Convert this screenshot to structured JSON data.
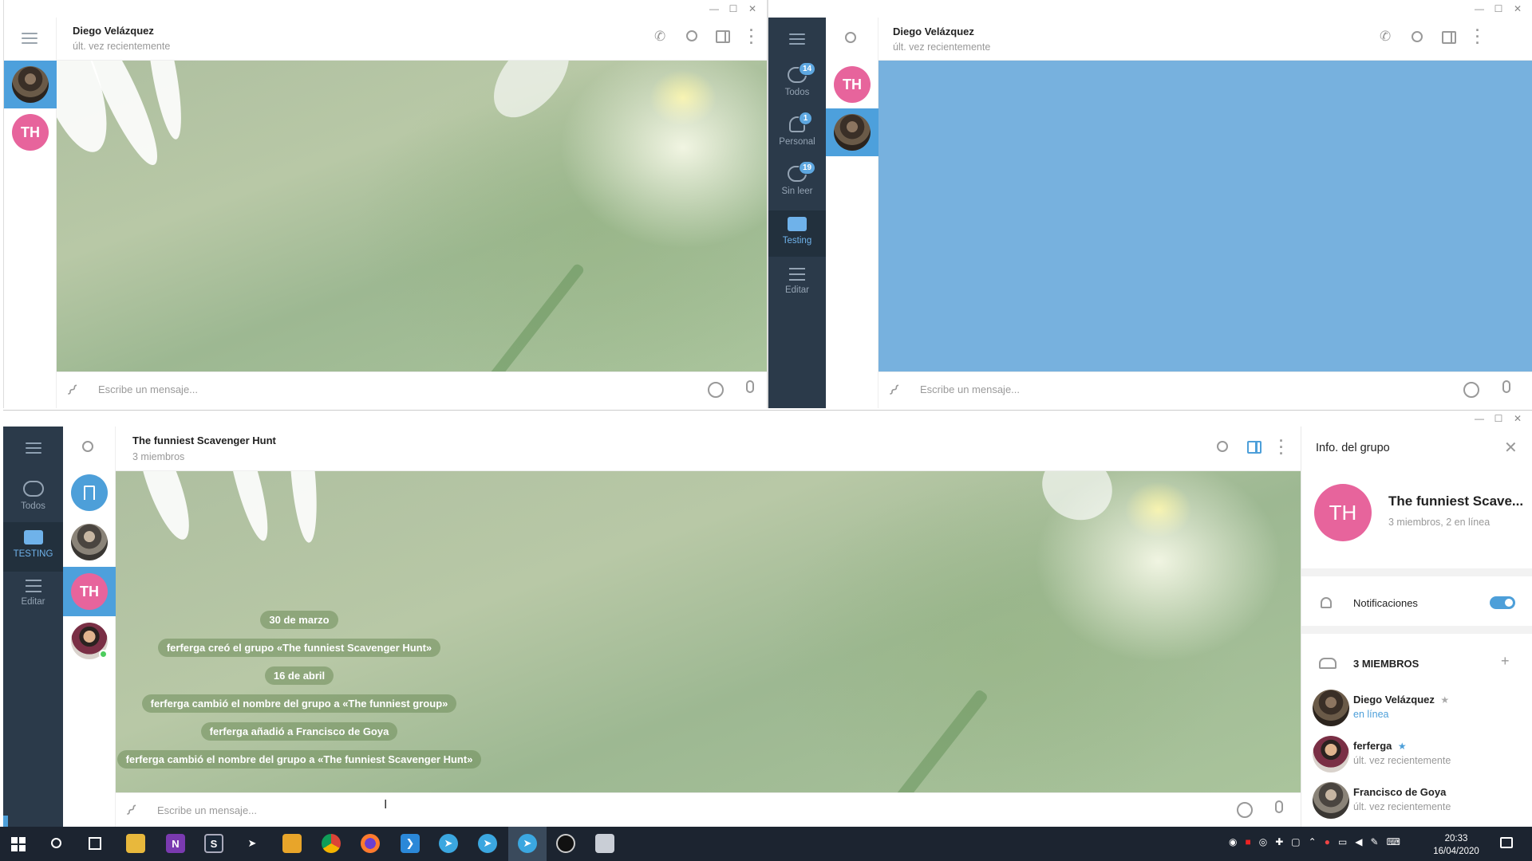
{
  "window_top_left": {
    "chat_title": "Diego Velázquez",
    "chat_status": "últ. vez recientemente",
    "composer_placeholder": "Escribe un mensaje...",
    "avatar_th": "TH"
  },
  "window_top_right": {
    "chat_title": "Diego Velázquez",
    "chat_status": "últ. vez recientemente",
    "composer_placeholder": "Escribe un mensaje...",
    "avatar_th": "TH",
    "folders": [
      {
        "label": "Todos",
        "badge": "14"
      },
      {
        "label": "Personal",
        "badge": "1"
      },
      {
        "label": "Sin leer",
        "badge": "19"
      },
      {
        "label": "Testing",
        "badge": ""
      },
      {
        "label": "Editar",
        "badge": ""
      }
    ]
  },
  "window_bottom": {
    "chat_title": "The funniest Scavenger Hunt",
    "chat_subtitle": "3 miembros",
    "composer_placeholder": "Escribe un mensaje...",
    "avatar_th": "TH",
    "folders": [
      {
        "label": "Todos"
      },
      {
        "label": "TESTING"
      },
      {
        "label": "Editar"
      }
    ],
    "service_messages": [
      "30 de marzo",
      "ferferga creó el grupo «The funniest Scavenger Hunt»",
      "16 de abril",
      "ferferga cambió el nombre del grupo a «The funniest group»",
      "ferferga añadió a Francisco de Goya",
      "ferferga cambió el nombre del grupo a «The funniest Scavenger Hunt»"
    ],
    "info_panel": {
      "title": "Info. del grupo",
      "group_avatar": "TH",
      "group_name": "The funniest Scave...",
      "group_stats": "3 miembros, 2 en línea",
      "notifications_label": "Notificaciones",
      "notifications_on": true,
      "members_header": "3 MIEMBROS",
      "members": [
        {
          "name": "Diego Velázquez",
          "star": "★",
          "status": "en línea"
        },
        {
          "name": "ferferga",
          "star": "★",
          "status": "últ. vez recientemente"
        },
        {
          "name": "Francisco de Goya",
          "star": "",
          "status": "últ. vez recientemente"
        }
      ]
    }
  },
  "taskbar": {
    "time": "20:33",
    "date": "16/04/2020"
  },
  "colors": {
    "sidebar_dark": "#2b3a4a",
    "accent": "#5ea7e0",
    "avatar_pink": "#e7649c",
    "chat_blue": "#77b1de"
  }
}
